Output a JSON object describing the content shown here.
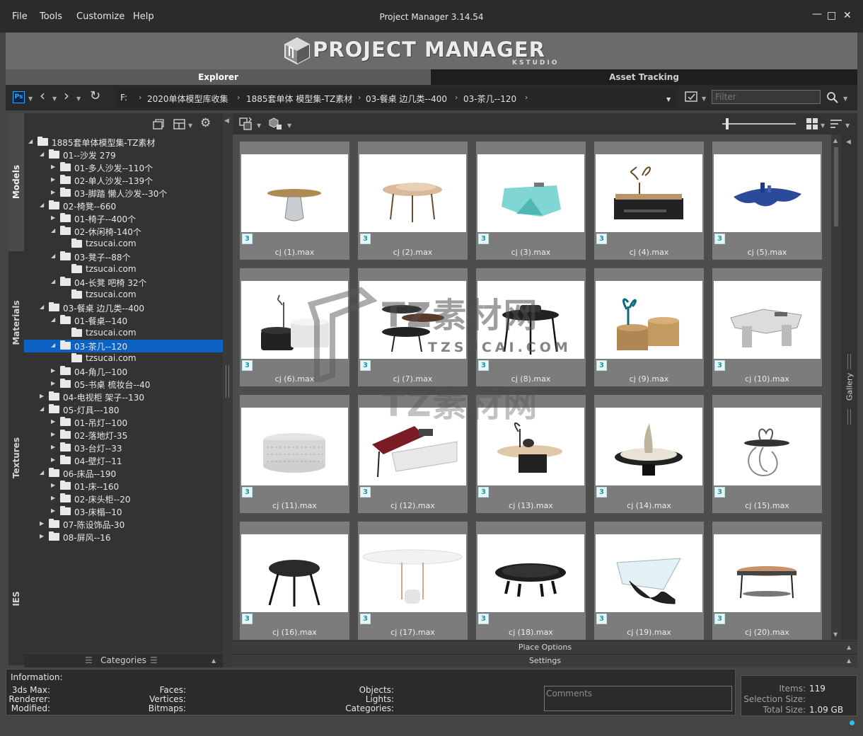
{
  "menu": {
    "file": "File",
    "tools": "Tools",
    "customize": "Customize",
    "help": "Help"
  },
  "window": {
    "title": "Project Manager 3.14.54"
  },
  "banner": {
    "logo_text": "PROJECT MANAGER",
    "logo_sub": "KSTUDIO"
  },
  "tabs": {
    "explorer": "Explorer",
    "asset_tracking": "Asset Tracking"
  },
  "nav": {
    "ps_label": "Ps",
    "breadcrumb": [
      "F:",
      "2020单体模型库收集",
      "1885套单体 模型集-TZ素材",
      "03-餐桌 边几类--400",
      "03-茶几--120"
    ],
    "filter_placeholder": "Filter"
  },
  "sidebar_tabs": [
    "Models",
    "Materials",
    "Textures",
    "IES"
  ],
  "tree": [
    {
      "label": "1885套单体模型集-TZ素材",
      "level": 0,
      "state": "open"
    },
    {
      "label": "01--沙发 279",
      "level": 1,
      "state": "open"
    },
    {
      "label": "01-多人沙发--110个",
      "level": 2,
      "state": "closed"
    },
    {
      "label": "02-单人沙发--139个",
      "level": 2,
      "state": "closed"
    },
    {
      "label": "03-脚踏 懒人沙发--30个",
      "level": 2,
      "state": "closed"
    },
    {
      "label": "02-椅凳--660",
      "level": 1,
      "state": "open"
    },
    {
      "label": "01-椅子--400个",
      "level": 2,
      "state": "closed"
    },
    {
      "label": "02-休闲椅-140个",
      "level": 2,
      "state": "open"
    },
    {
      "label": "tzsucai.com",
      "level": 3,
      "state": "leaf"
    },
    {
      "label": "03-凳子--88个",
      "level": 2,
      "state": "open"
    },
    {
      "label": "tzsucai.com",
      "level": 3,
      "state": "leaf"
    },
    {
      "label": "04-长凳 吧椅 32个",
      "level": 2,
      "state": "open"
    },
    {
      "label": "tzsucai.com",
      "level": 3,
      "state": "leaf"
    },
    {
      "label": "03-餐桌 边几类--400",
      "level": 1,
      "state": "open"
    },
    {
      "label": "01-餐桌--140",
      "level": 2,
      "state": "open"
    },
    {
      "label": "tzsucai.com",
      "level": 3,
      "state": "leaf"
    },
    {
      "label": "03-茶几--120",
      "level": 2,
      "state": "open",
      "selected": true
    },
    {
      "label": "tzsucai.com",
      "level": 3,
      "state": "leaf"
    },
    {
      "label": "04-角几--100",
      "level": 2,
      "state": "closed"
    },
    {
      "label": "05-书桌 梳妆台--40",
      "level": 2,
      "state": "closed"
    },
    {
      "label": "04-电视柜 架子--130",
      "level": 1,
      "state": "closed"
    },
    {
      "label": "05-灯具---180",
      "level": 1,
      "state": "open"
    },
    {
      "label": "01-吊灯--100",
      "level": 2,
      "state": "closed"
    },
    {
      "label": "02-落地灯-35",
      "level": 2,
      "state": "closed"
    },
    {
      "label": "03-台灯--33",
      "level": 2,
      "state": "closed"
    },
    {
      "label": "04-壁灯--11",
      "level": 2,
      "state": "closed"
    },
    {
      "label": "06-床品--190",
      "level": 1,
      "state": "open"
    },
    {
      "label": "01-床--160",
      "level": 2,
      "state": "closed"
    },
    {
      "label": "02-床头柜--20",
      "level": 2,
      "state": "closed"
    },
    {
      "label": "03-床榻--10",
      "level": 2,
      "state": "closed"
    },
    {
      "label": "07-陈设饰品-30",
      "level": 1,
      "state": "closed"
    },
    {
      "label": "08-屏风--16",
      "level": 1,
      "state": "closed"
    }
  ],
  "categories_label": "Categories",
  "gallery": {
    "badge": "3",
    "items": [
      "cj (1).max",
      "cj (2).max",
      "cj (3).max",
      "cj (4).max",
      "cj (5).max",
      "cj (6).max",
      "cj (7).max",
      "cj (8).max",
      "cj (9).max",
      "cj (10).max",
      "cj (11).max",
      "cj (12).max",
      "cj (13).max",
      "cj (14).max",
      "cj (15).max",
      "cj (16).max",
      "cj (17).max",
      "cj (18).max",
      "cj (19).max",
      "cj (20).max"
    ],
    "side_label": "Gallery"
  },
  "watermark": {
    "title": "TZ素材网",
    "sub": "TZSUCAI.COM"
  },
  "place_options": "Place Options",
  "settings": "Settings",
  "info": {
    "title": "Information:",
    "max": "3ds Max:",
    "renderer": "Renderer:",
    "modified": "Modified:",
    "faces": "Faces:",
    "vertices": "Vertices:",
    "bitmaps": "Bitmaps:",
    "objects": "Objects:",
    "lights": "Lights:",
    "categories": "Categories:",
    "comments_placeholder": "Comments"
  },
  "stats": {
    "items_label": "Items:",
    "items_value": "119",
    "selection_label": "Selection Size:",
    "selection_value": "",
    "total_label": "Total Size:",
    "total_value": "1.09 GB"
  },
  "colors": {
    "selected": "#0b62c2",
    "accent": "#25c3e8"
  }
}
